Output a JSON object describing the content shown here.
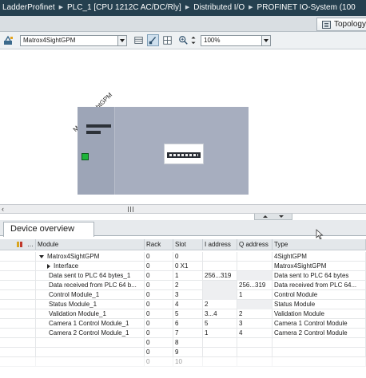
{
  "breadcrumb": [
    "LadderProfinet",
    "PLC_1 [CPU 1212C AC/DC/Rly]",
    "Distributed I/O",
    "PROFINET IO-System (100"
  ],
  "topology_tab": "Topology",
  "toolbar": {
    "device_select_value": "Matrox4SightGPM",
    "zoom_value": "100%"
  },
  "canvas": {
    "device_label": "Matrox4SightGPM"
  },
  "device_overview": {
    "tab_label": "Device overview",
    "columns": [
      "Module",
      "Rack",
      "Slot",
      "I address",
      "Q address",
      "Type"
    ],
    "rows": [
      {
        "module": "Matrox4SightGPM",
        "rack": "0",
        "slot": "0",
        "iaddr": "",
        "qaddr": "",
        "type": "4SightGPM",
        "expander": "down",
        "indent": 1
      },
      {
        "module": "Interface",
        "rack": "0",
        "slot": "0 X1",
        "iaddr": "",
        "qaddr": "",
        "type": "Matrox4SightGPM",
        "expander": "right",
        "indent": 2
      },
      {
        "module": "Data sent to PLC 64 bytes_1",
        "rack": "0",
        "slot": "1",
        "iaddr": "256...319",
        "qaddr": "",
        "type": "Data sent to PLC 64 bytes",
        "expander": "",
        "indent": 0
      },
      {
        "module": "Data received from PLC 64 b...",
        "rack": "0",
        "slot": "2",
        "iaddr": "",
        "qaddr": "256...319",
        "type": "Data received from PLC 64...",
        "expander": "",
        "indent": 0
      },
      {
        "module": "Control Module_1",
        "rack": "0",
        "slot": "3",
        "iaddr": "",
        "qaddr": "1",
        "type": "Control Module",
        "expander": "",
        "indent": 0
      },
      {
        "module": "Status Module_1",
        "rack": "0",
        "slot": "4",
        "iaddr": "2",
        "qaddr": "",
        "type": "Status Module",
        "expander": "",
        "indent": 0
      },
      {
        "module": "Validation Module_1",
        "rack": "0",
        "slot": "5",
        "iaddr": "3...4",
        "qaddr": "2",
        "type": "Validation Module",
        "expander": "",
        "indent": 0
      },
      {
        "module": "Camera 1 Control Module_1",
        "rack": "0",
        "slot": "6",
        "iaddr": "5",
        "qaddr": "3",
        "type": "Camera 1 Control Module",
        "expander": "",
        "indent": 0
      },
      {
        "module": "Camera 2 Control Module_1",
        "rack": "0",
        "slot": "7",
        "iaddr": "1",
        "qaddr": "4",
        "type": "Camera 2 Control Module",
        "expander": "",
        "indent": 0
      },
      {
        "module": "",
        "rack": "0",
        "slot": "8",
        "iaddr": "",
        "qaddr": "",
        "type": "",
        "expander": "",
        "indent": 0
      },
      {
        "module": "",
        "rack": "0",
        "slot": "9",
        "iaddr": "",
        "qaddr": "",
        "type": "",
        "expander": "",
        "indent": 0
      },
      {
        "module": "",
        "rack": "0",
        "slot": "10",
        "iaddr": "",
        "qaddr": "",
        "type": "",
        "expander": "",
        "indent": 0
      }
    ]
  },
  "colors": {
    "titlebar": "#25404f",
    "rack": "#a7aebf",
    "port_green": "#1db43a"
  }
}
